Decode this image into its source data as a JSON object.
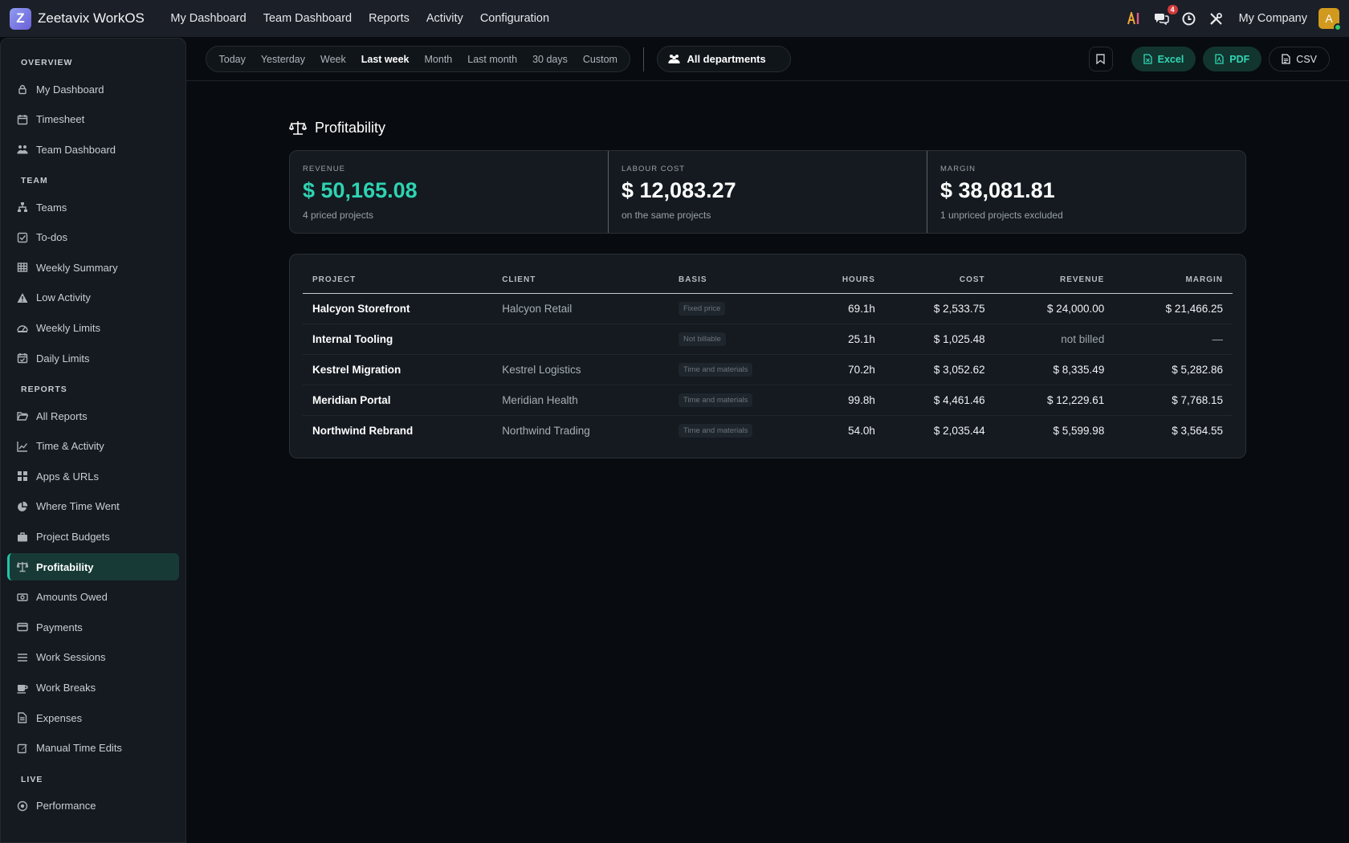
{
  "app": {
    "brand_letter": "Z",
    "brand_name": "Zeetavix WorkOS",
    "top_nav": [
      "My Dashboard",
      "Team Dashboard",
      "Reports",
      "Activity",
      "Configuration"
    ],
    "notifications_count": "4",
    "company": "My Company",
    "avatar_letter": "A",
    "accent_color": "#22c4a8"
  },
  "sidebar": {
    "sections": [
      {
        "title": "OVERVIEW",
        "items": [
          {
            "label": "My Dashboard",
            "icon": "lock-icon"
          },
          {
            "label": "Timesheet",
            "icon": "calendar-icon"
          },
          {
            "label": "Team Dashboard",
            "icon": "users-icon"
          }
        ]
      },
      {
        "title": "TEAM",
        "items": [
          {
            "label": "Teams",
            "icon": "sitemap-icon"
          },
          {
            "label": "To-dos",
            "icon": "check-square-icon"
          },
          {
            "label": "Weekly Summary",
            "icon": "table-icon"
          },
          {
            "label": "Low Activity",
            "icon": "warning-icon"
          },
          {
            "label": "Weekly Limits",
            "icon": "gauge-icon"
          },
          {
            "label": "Daily Limits",
            "icon": "calendar-check-icon"
          }
        ]
      },
      {
        "title": "REPORTS",
        "items": [
          {
            "label": "All Reports",
            "icon": "folder-open-icon"
          },
          {
            "label": "Time & Activity",
            "icon": "line-chart-icon"
          },
          {
            "label": "Apps & URLs",
            "icon": "grid-icon"
          },
          {
            "label": "Where Time Went",
            "icon": "pie-chart-icon"
          },
          {
            "label": "Project Budgets",
            "icon": "briefcase-icon"
          },
          {
            "label": "Profitability",
            "icon": "scale-icon",
            "active": true
          },
          {
            "label": "Amounts Owed",
            "icon": "money-icon"
          },
          {
            "label": "Payments",
            "icon": "credit-card-icon"
          },
          {
            "label": "Work Sessions",
            "icon": "list-icon"
          },
          {
            "label": "Work Breaks",
            "icon": "coffee-icon"
          },
          {
            "label": "Expenses",
            "icon": "file-icon"
          },
          {
            "label": "Manual Time Edits",
            "icon": "edit-icon"
          }
        ]
      },
      {
        "title": "LIVE",
        "items": [
          {
            "label": "Performance",
            "icon": "target-icon"
          }
        ]
      }
    ]
  },
  "toolbar": {
    "ranges": [
      "Today",
      "Yesterday",
      "Week",
      "Last week",
      "Month",
      "Last month",
      "30 days",
      "Custom"
    ],
    "active_range": "Last week",
    "department": "All departments",
    "export_excel": "Excel",
    "export_pdf": "PDF",
    "export_csv": "CSV"
  },
  "page": {
    "title": "Profitability",
    "stats": [
      {
        "label": "REVENUE",
        "value": "$ 50,165.08",
        "sub": "4 priced projects",
        "highlight": true
      },
      {
        "label": "LABOUR COST",
        "value": "$ 12,083.27",
        "sub": "on the same projects",
        "highlight": false
      },
      {
        "label": "MARGIN",
        "value": "$ 38,081.81",
        "sub": "1 unpriced projects excluded",
        "highlight": false
      }
    ],
    "table": {
      "headers": [
        "PROJECT",
        "CLIENT",
        "BASIS",
        "HOURS",
        "COST",
        "REVENUE",
        "MARGIN"
      ],
      "rows": [
        {
          "project": "Halcyon Storefront",
          "client": "Halcyon Retail",
          "basis": "Fixed price",
          "hours": "69.1h",
          "cost": "$ 2,533.75",
          "revenue": "$ 24,000.00",
          "margin": "$ 21,466.25"
        },
        {
          "project": "Internal Tooling",
          "client": "",
          "basis": "Not billable",
          "hours": "25.1h",
          "cost": "$ 1,025.48",
          "revenue": "not billed",
          "margin": "—"
        },
        {
          "project": "Kestrel Migration",
          "client": "Kestrel Logistics",
          "basis": "Time and materials",
          "hours": "70.2h",
          "cost": "$ 3,052.62",
          "revenue": "$ 8,335.49",
          "margin": "$ 5,282.86"
        },
        {
          "project": "Meridian Portal",
          "client": "Meridian Health",
          "basis": "Time and materials",
          "hours": "99.8h",
          "cost": "$ 4,461.46",
          "revenue": "$ 12,229.61",
          "margin": "$ 7,768.15"
        },
        {
          "project": "Northwind Rebrand",
          "client": "Northwind Trading",
          "basis": "Time and materials",
          "hours": "54.0h",
          "cost": "$ 2,035.44",
          "revenue": "$ 5,599.98",
          "margin": "$ 3,564.55"
        }
      ]
    }
  }
}
